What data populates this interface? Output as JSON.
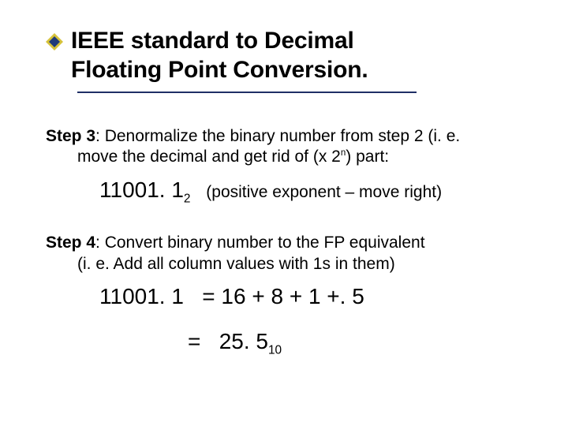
{
  "title": {
    "line1": "IEEE standard to Decimal",
    "line2": "Floating Point Conversion.",
    "bullet_icon": "diamond-bullet",
    "bullet_colors": {
      "outer": "#d6c23a",
      "inner": "#1f3a7a"
    }
  },
  "step3": {
    "label": "Step 3",
    "text": ":  Denormalize the binary number from step 2 (i. e.",
    "cont": "move the decimal and get rid of (x 2",
    "cont_sup": "n",
    "cont_tail": ") part:",
    "value": "11001. 1",
    "value_sub": "2",
    "annotation": "(positive exponent – move right)"
  },
  "step4": {
    "label": "Step 4",
    "text": ":  Convert binary number to the FP equivalent",
    "cont": "(i. e. Add all column values with 1s in them)",
    "eq_lhs": "11001. 1",
    "eq_eq": "=",
    "eq_rhs": "16 + 8 + 1 +. 5",
    "ans_eq": "=",
    "ans_val": "25. 5",
    "ans_sub": "10"
  }
}
